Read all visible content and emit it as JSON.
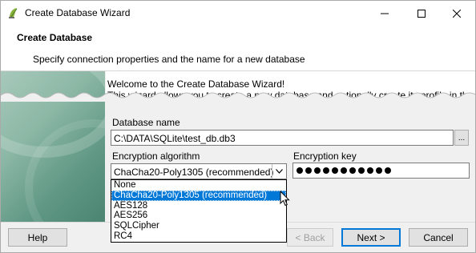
{
  "window": {
    "title": "Create Database Wizard",
    "controls": [
      "minimize",
      "maximize",
      "close"
    ]
  },
  "header": {
    "title": "Create Database",
    "subtitle": "Specify connection properties and the name for a new database"
  },
  "welcome": {
    "line1": "Welcome to the Create Database Wizard!",
    "line2": "This wizard allows you to create a new database and optionally create its profile in the"
  },
  "form": {
    "database_name_label": "Database name",
    "database_name_value": "C:\\DATA\\SQLite\\test_db.db3",
    "browse_label": "...",
    "encryption_algorithm_label": "Encryption algorithm",
    "encryption_algorithm_value": "ChaCha20-Poly1305 (recommended)",
    "encryption_key_label": "Encryption key",
    "encryption_key_masked_length": 11
  },
  "dropdown": {
    "options": [
      "None",
      "ChaCha20-Poly1305 (recommended)",
      "AES128",
      "AES256",
      "SQLCipher",
      "RC4"
    ],
    "selected_index": 1
  },
  "buttons": {
    "help": "Help",
    "back": "< Back",
    "next": "Next >",
    "cancel": "Cancel"
  },
  "colors": {
    "selection": "#0078d7",
    "side_panel": "#6fa592"
  }
}
